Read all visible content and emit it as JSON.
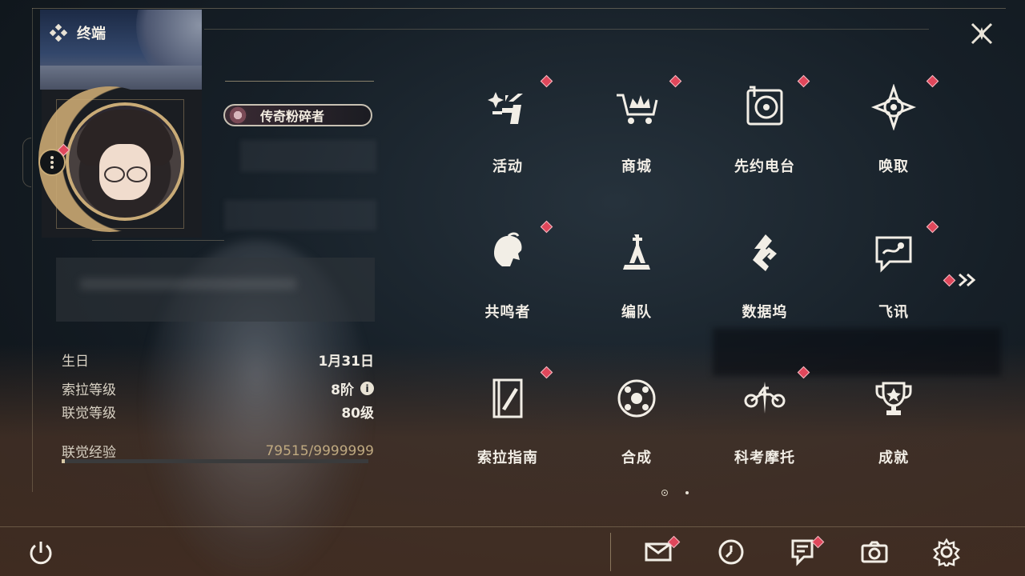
{
  "header": {
    "title": "终端"
  },
  "profile": {
    "title_badge": "传奇粉碎者",
    "stats": {
      "birthday_label": "生日",
      "birthday_value": "1月31日",
      "sola_level_label": "索拉等级",
      "sola_level_value": "8阶",
      "union_level_label": "联觉等级",
      "union_level_value": "80级",
      "union_exp_label": "联觉经验",
      "union_exp_value": "79515/9999999",
      "union_exp_progress": 0.008
    }
  },
  "menu": {
    "items": [
      {
        "label": "活动",
        "icon": "events-icon",
        "badge": true
      },
      {
        "label": "商城",
        "icon": "shop-cart-icon",
        "badge": true
      },
      {
        "label": "先约电台",
        "icon": "radio-icon",
        "badge": true
      },
      {
        "label": "唤取",
        "icon": "convene-icon",
        "badge": true
      },
      {
        "label": "共鸣者",
        "icon": "resonator-icon",
        "badge": true
      },
      {
        "label": "编队",
        "icon": "chess-team-icon",
        "badge": false
      },
      {
        "label": "数据坞",
        "icon": "data-bank-icon",
        "badge": false
      },
      {
        "label": "飞讯",
        "icon": "message-icon",
        "badge": true
      },
      {
        "label": "索拉指南",
        "icon": "guidebook-icon",
        "badge": true
      },
      {
        "label": "合成",
        "icon": "synthesis-icon",
        "badge": false
      },
      {
        "label": "科考摩托",
        "icon": "motorcycle-icon",
        "badge": true
      },
      {
        "label": "成就",
        "icon": "trophy-icon",
        "badge": false
      }
    ],
    "next_page_icon": "double-chevron-right-icon"
  },
  "pager": {
    "current": 1,
    "total": 2
  },
  "bottom_bar": {
    "buttons": [
      "power-icon",
      "mail-icon",
      "clock-icon",
      "notice-icon",
      "camera-icon",
      "settings-gear-icon"
    ]
  },
  "colors": {
    "accent_gold": "#c9ab77",
    "badge_red": "#e0475b",
    "text": "#f2eee6"
  }
}
